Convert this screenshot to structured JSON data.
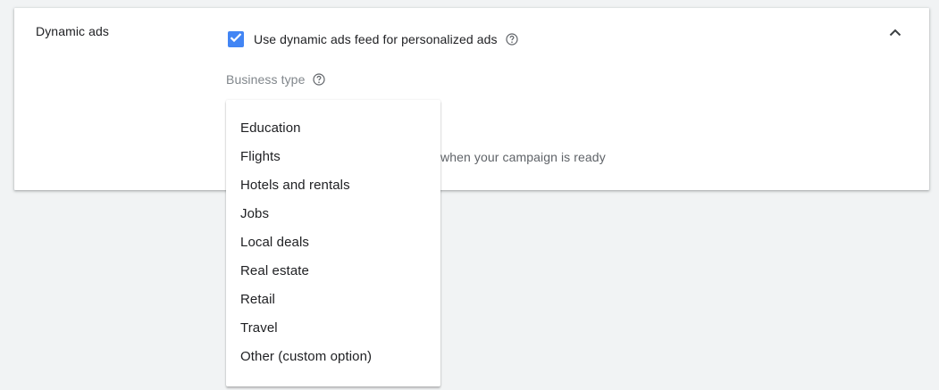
{
  "section": {
    "title": "Dynamic ads"
  },
  "feed": {
    "checked": true,
    "label": "Use dynamic ads feed for personalized ads"
  },
  "business_type": {
    "label": "Business type"
  },
  "background_hint": "when your campaign is ready",
  "dropdown": {
    "options": [
      "Education",
      "Flights",
      "Hotels and rentals",
      "Jobs",
      "Local deals",
      "Real estate",
      "Retail",
      "Travel",
      "Other (custom option)"
    ]
  },
  "colors": {
    "accent": "#4285f4",
    "text_primary": "#202124",
    "text_secondary": "#80868b",
    "page_background": "#f1f3f4"
  }
}
